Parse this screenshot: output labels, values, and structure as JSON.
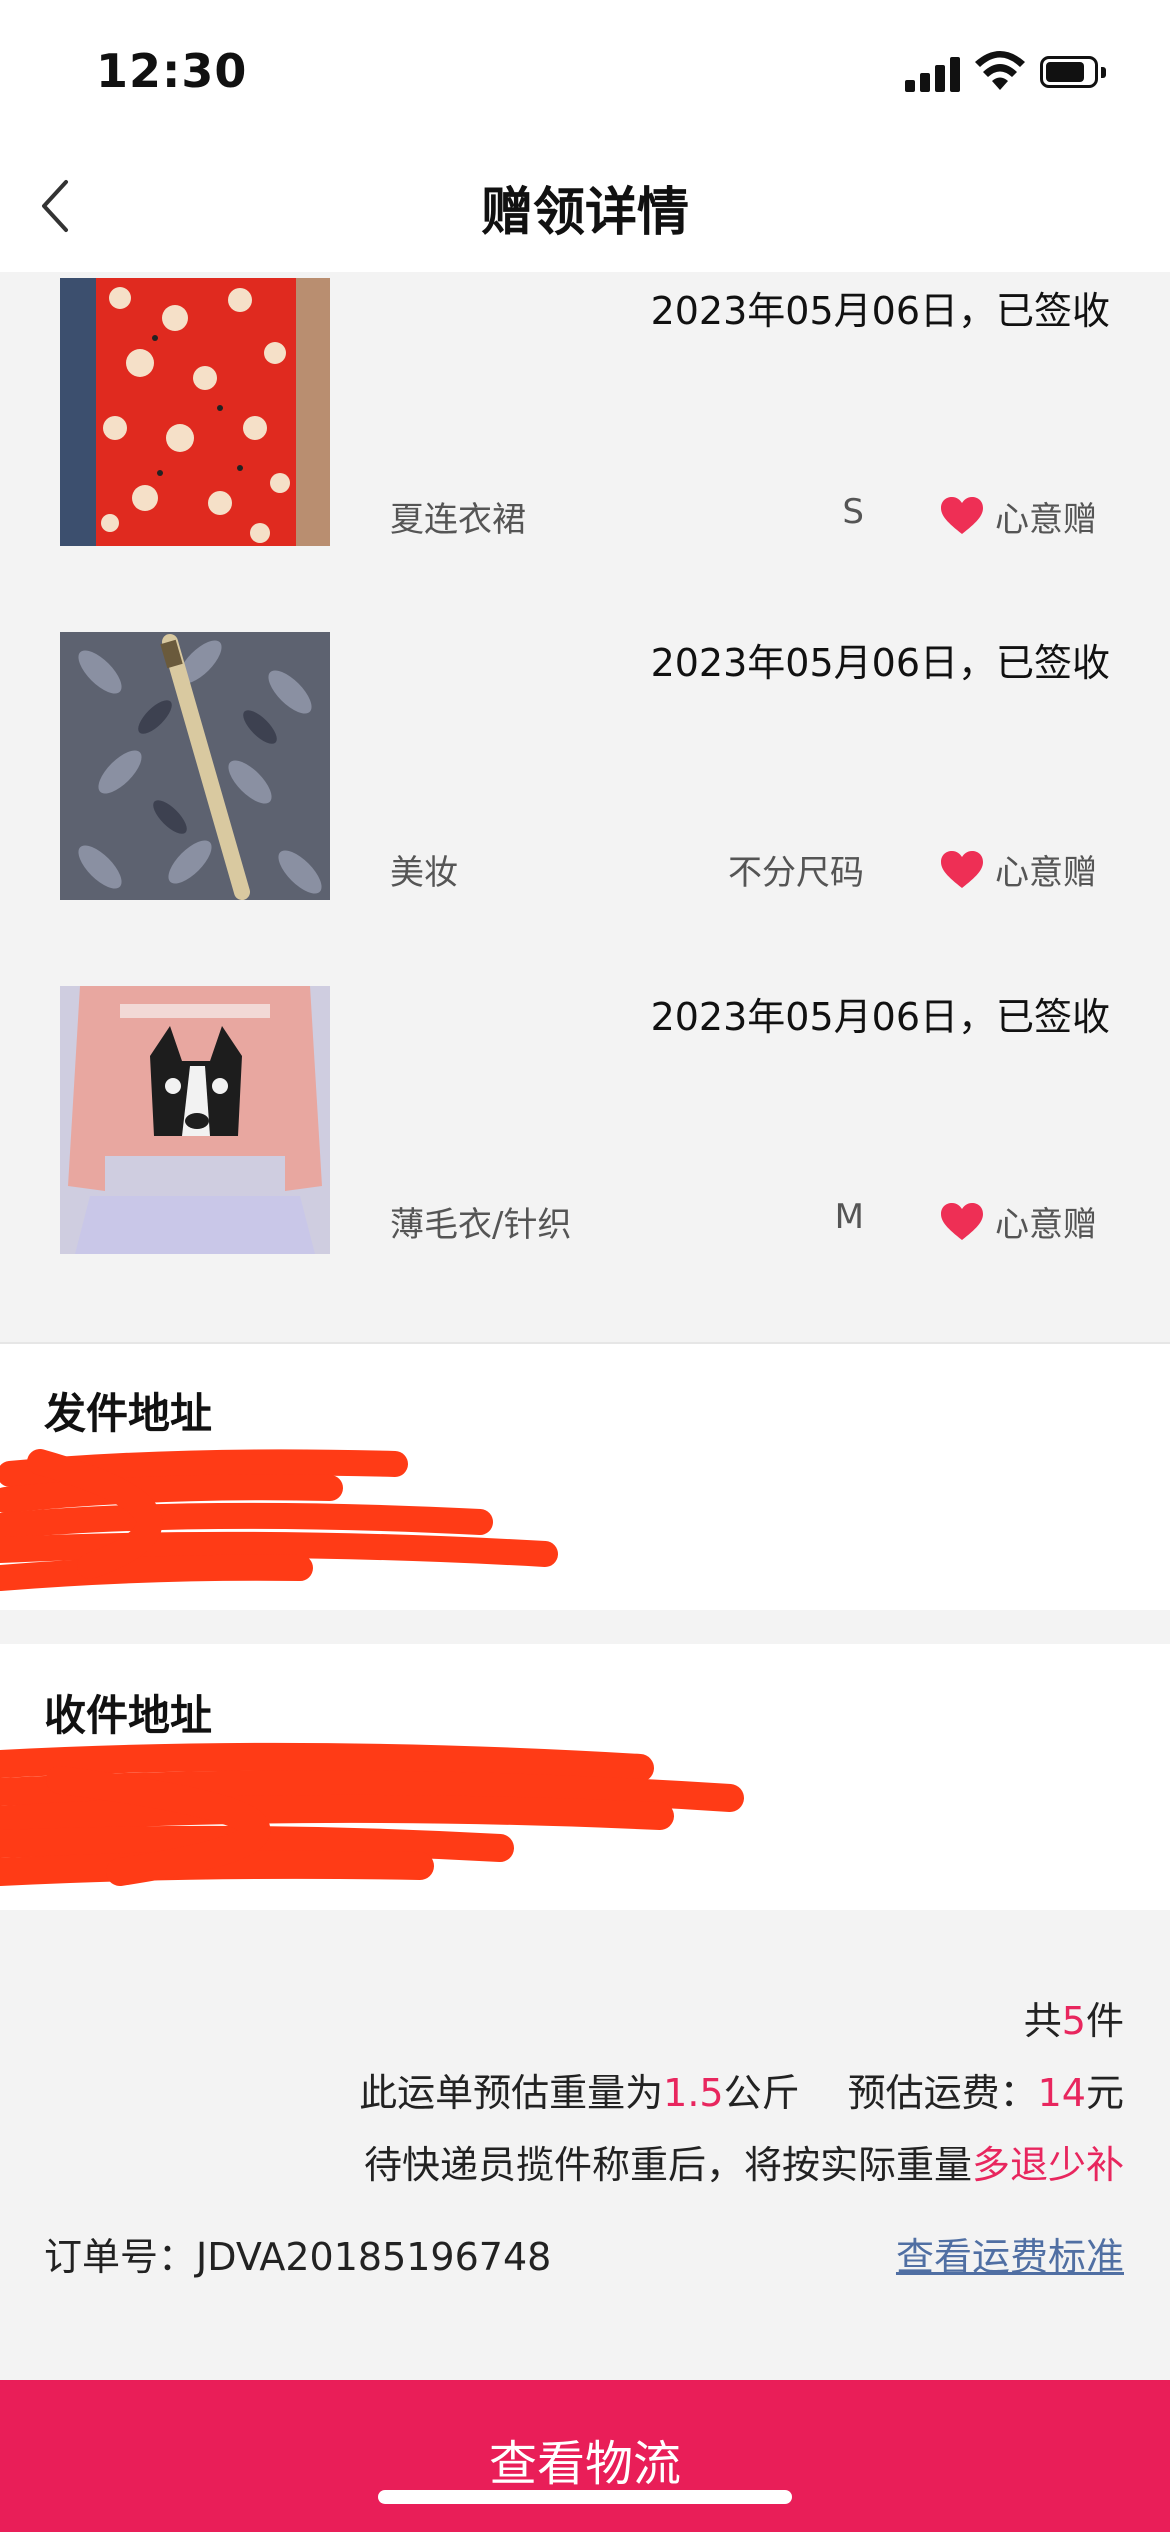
{
  "status_bar": {
    "time": "12:30"
  },
  "nav": {
    "title": "赠领详情"
  },
  "items": [
    {
      "date": "2023年05月06日，已签收",
      "category": "夏连衣裙",
      "size": "S",
      "tag": "心意赠"
    },
    {
      "date": "2023年05月06日，已签收",
      "category": "美妆",
      "size": "不分尺码",
      "tag": "心意赠"
    },
    {
      "date": "2023年05月06日，已签收",
      "category": "薄毛衣/针织",
      "size": "M",
      "tag": "心意赠"
    }
  ],
  "sender": {
    "title": "发件地址"
  },
  "receiver": {
    "title": "收件地址"
  },
  "summary": {
    "count_prefix": "共",
    "count": "5",
    "count_suffix": "件",
    "weight_prefix": "此运单预估重量为",
    "weight": "1.5",
    "weight_unit": "公斤",
    "fee_prefix": "预估运费：",
    "fee": "14",
    "fee_unit": "元",
    "note_prefix": "待快递员揽件称重后，将按实际重量",
    "note_highlight": "多退少补",
    "order_label": "订单号：",
    "order_number": "JDVA20185196748",
    "fee_link": "查看运费标准"
  },
  "button": {
    "label": "查看物流"
  },
  "colors": {
    "accent": "#e91e58",
    "highlight_text": "#e8265e",
    "link": "#506fa3",
    "scribble": "#ff3b16"
  }
}
